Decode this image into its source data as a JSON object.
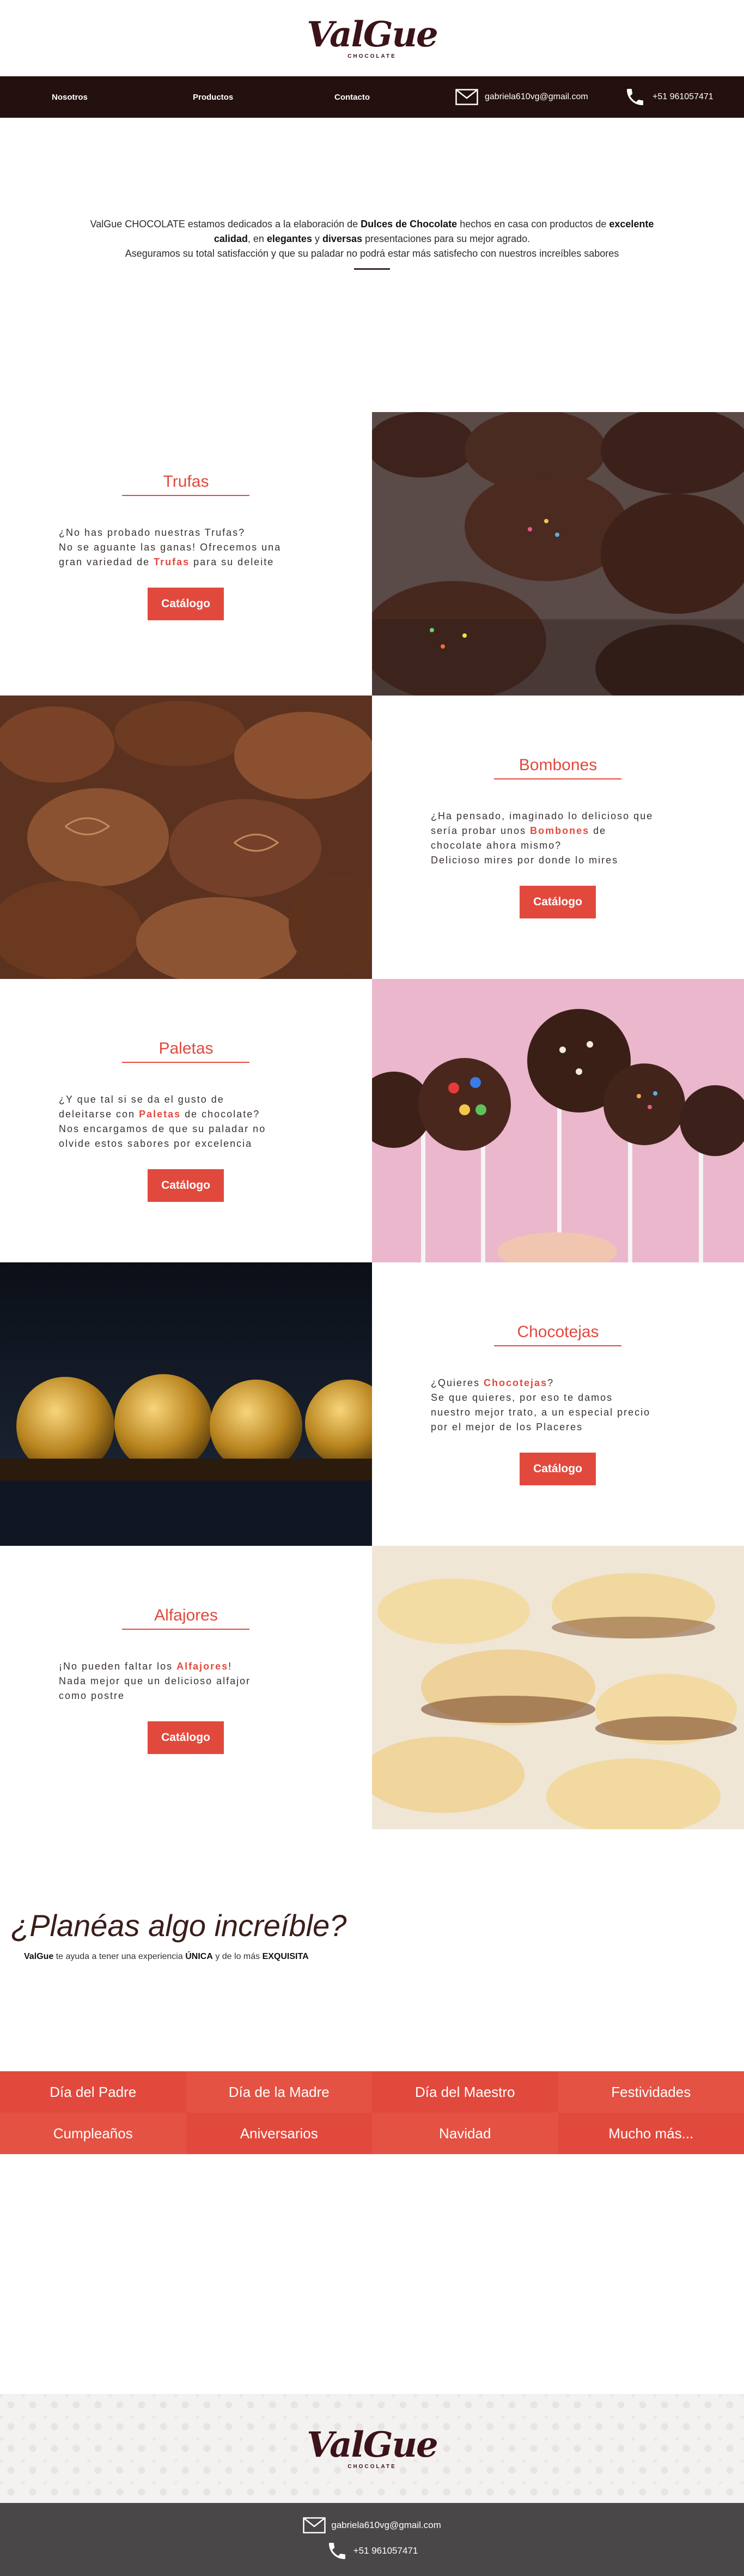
{
  "brand": {
    "logo_script": "ValGue",
    "logo_sub": "CHOCOLATE"
  },
  "nav": {
    "items": [
      {
        "label": "Nosotros"
      },
      {
        "label": "Productos"
      },
      {
        "label": "Contacto"
      }
    ],
    "email": "gabriela610vg@gmail.com",
    "phone": "+51 961057471"
  },
  "intro": {
    "line1_pre": "ValGue CHOCOLATE estamos dedicados a la elaboración de ",
    "line1_bold": "Dulces de Chocolate",
    "line1_mid": " hechos en casa con productos de ",
    "line1_bold2": "excelente",
    "line2_bold1": "calidad",
    "line2_mid1": ", en ",
    "line2_bold2": "elegantes",
    "line2_mid2": " y ",
    "line2_bold3": "diversas",
    "line2_post": " presentaciones para su mejor agrado.",
    "line3": "Aseguramos su total satisfacción y que su paladar no podrá estar más satisfecho con nuestros increíbles sabores"
  },
  "products": [
    {
      "title": "Trufas",
      "d1": "¿No has probado nuestras Trufas?",
      "d2": "No se aguante las ganas! Ofrecemos una",
      "d3_pre": "gran variedad de ",
      "d3_bold": "Trufas",
      "d3_post": " para su deleite",
      "button": "Catálogo"
    },
    {
      "title": "Bombones",
      "d1": "¿Ha pensado, imaginado lo delicioso que",
      "d2_pre": "sería probar unos ",
      "d2_bold": "Bombones",
      "d2_post": " de",
      "d3": "chocolate ahora mismo?",
      "d4": "Delicioso mires por donde lo mires",
      "button": "Catálogo"
    },
    {
      "title": "Paletas",
      "d1": "¿Y que tal si se da el gusto de",
      "d2_pre": "deleitarse con ",
      "d2_bold": "Paletas",
      "d2_post": " de chocolate?",
      "d3": "Nos encargamos de que su paladar no",
      "d4": "olvide estos sabores por excelencia",
      "button": "Catálogo"
    },
    {
      "title": "Chocotejas",
      "d1_pre": "¿Quieres ",
      "d1_bold": "Chocotejas",
      "d1_post": "?",
      "d2": "Se que quieres, por eso te damos",
      "d3": "nuestro mejor trato, a un especial precio",
      "d4": "por el mejor de los Placeres",
      "button": "Catálogo"
    },
    {
      "title": "Alfajores",
      "d1_pre": "¡No pueden faltar los ",
      "d1_bold": "Alfajores",
      "d1_post": "!",
      "d2": "Nada mejor que un delicioso alfajor",
      "d3": "como postre",
      "button": "Catálogo"
    }
  ],
  "plan": {
    "title": "¿Planéas algo increíble?",
    "sub_brand": "ValGue",
    "sub_mid": " te ayuda a tener una experiencia ",
    "sub_bold1": "ÚNICA",
    "sub_mid2": " y de lo más ",
    "sub_bold2": "EXQUISITA"
  },
  "occasions": [
    "Día del Padre",
    "Día de la Madre",
    "Día del Maestro",
    "Festividades",
    "Cumpleaños",
    "Aniversarios",
    "Navidad",
    "Mucho más..."
  ],
  "colors": {
    "accent": "#e2493d",
    "nav_bg": "#23100f",
    "brand": "#3b1318",
    "footer_bg": "#4a4748"
  },
  "footer": {
    "email": "gabriela610vg@gmail.com",
    "phone": "+51 961057471"
  }
}
